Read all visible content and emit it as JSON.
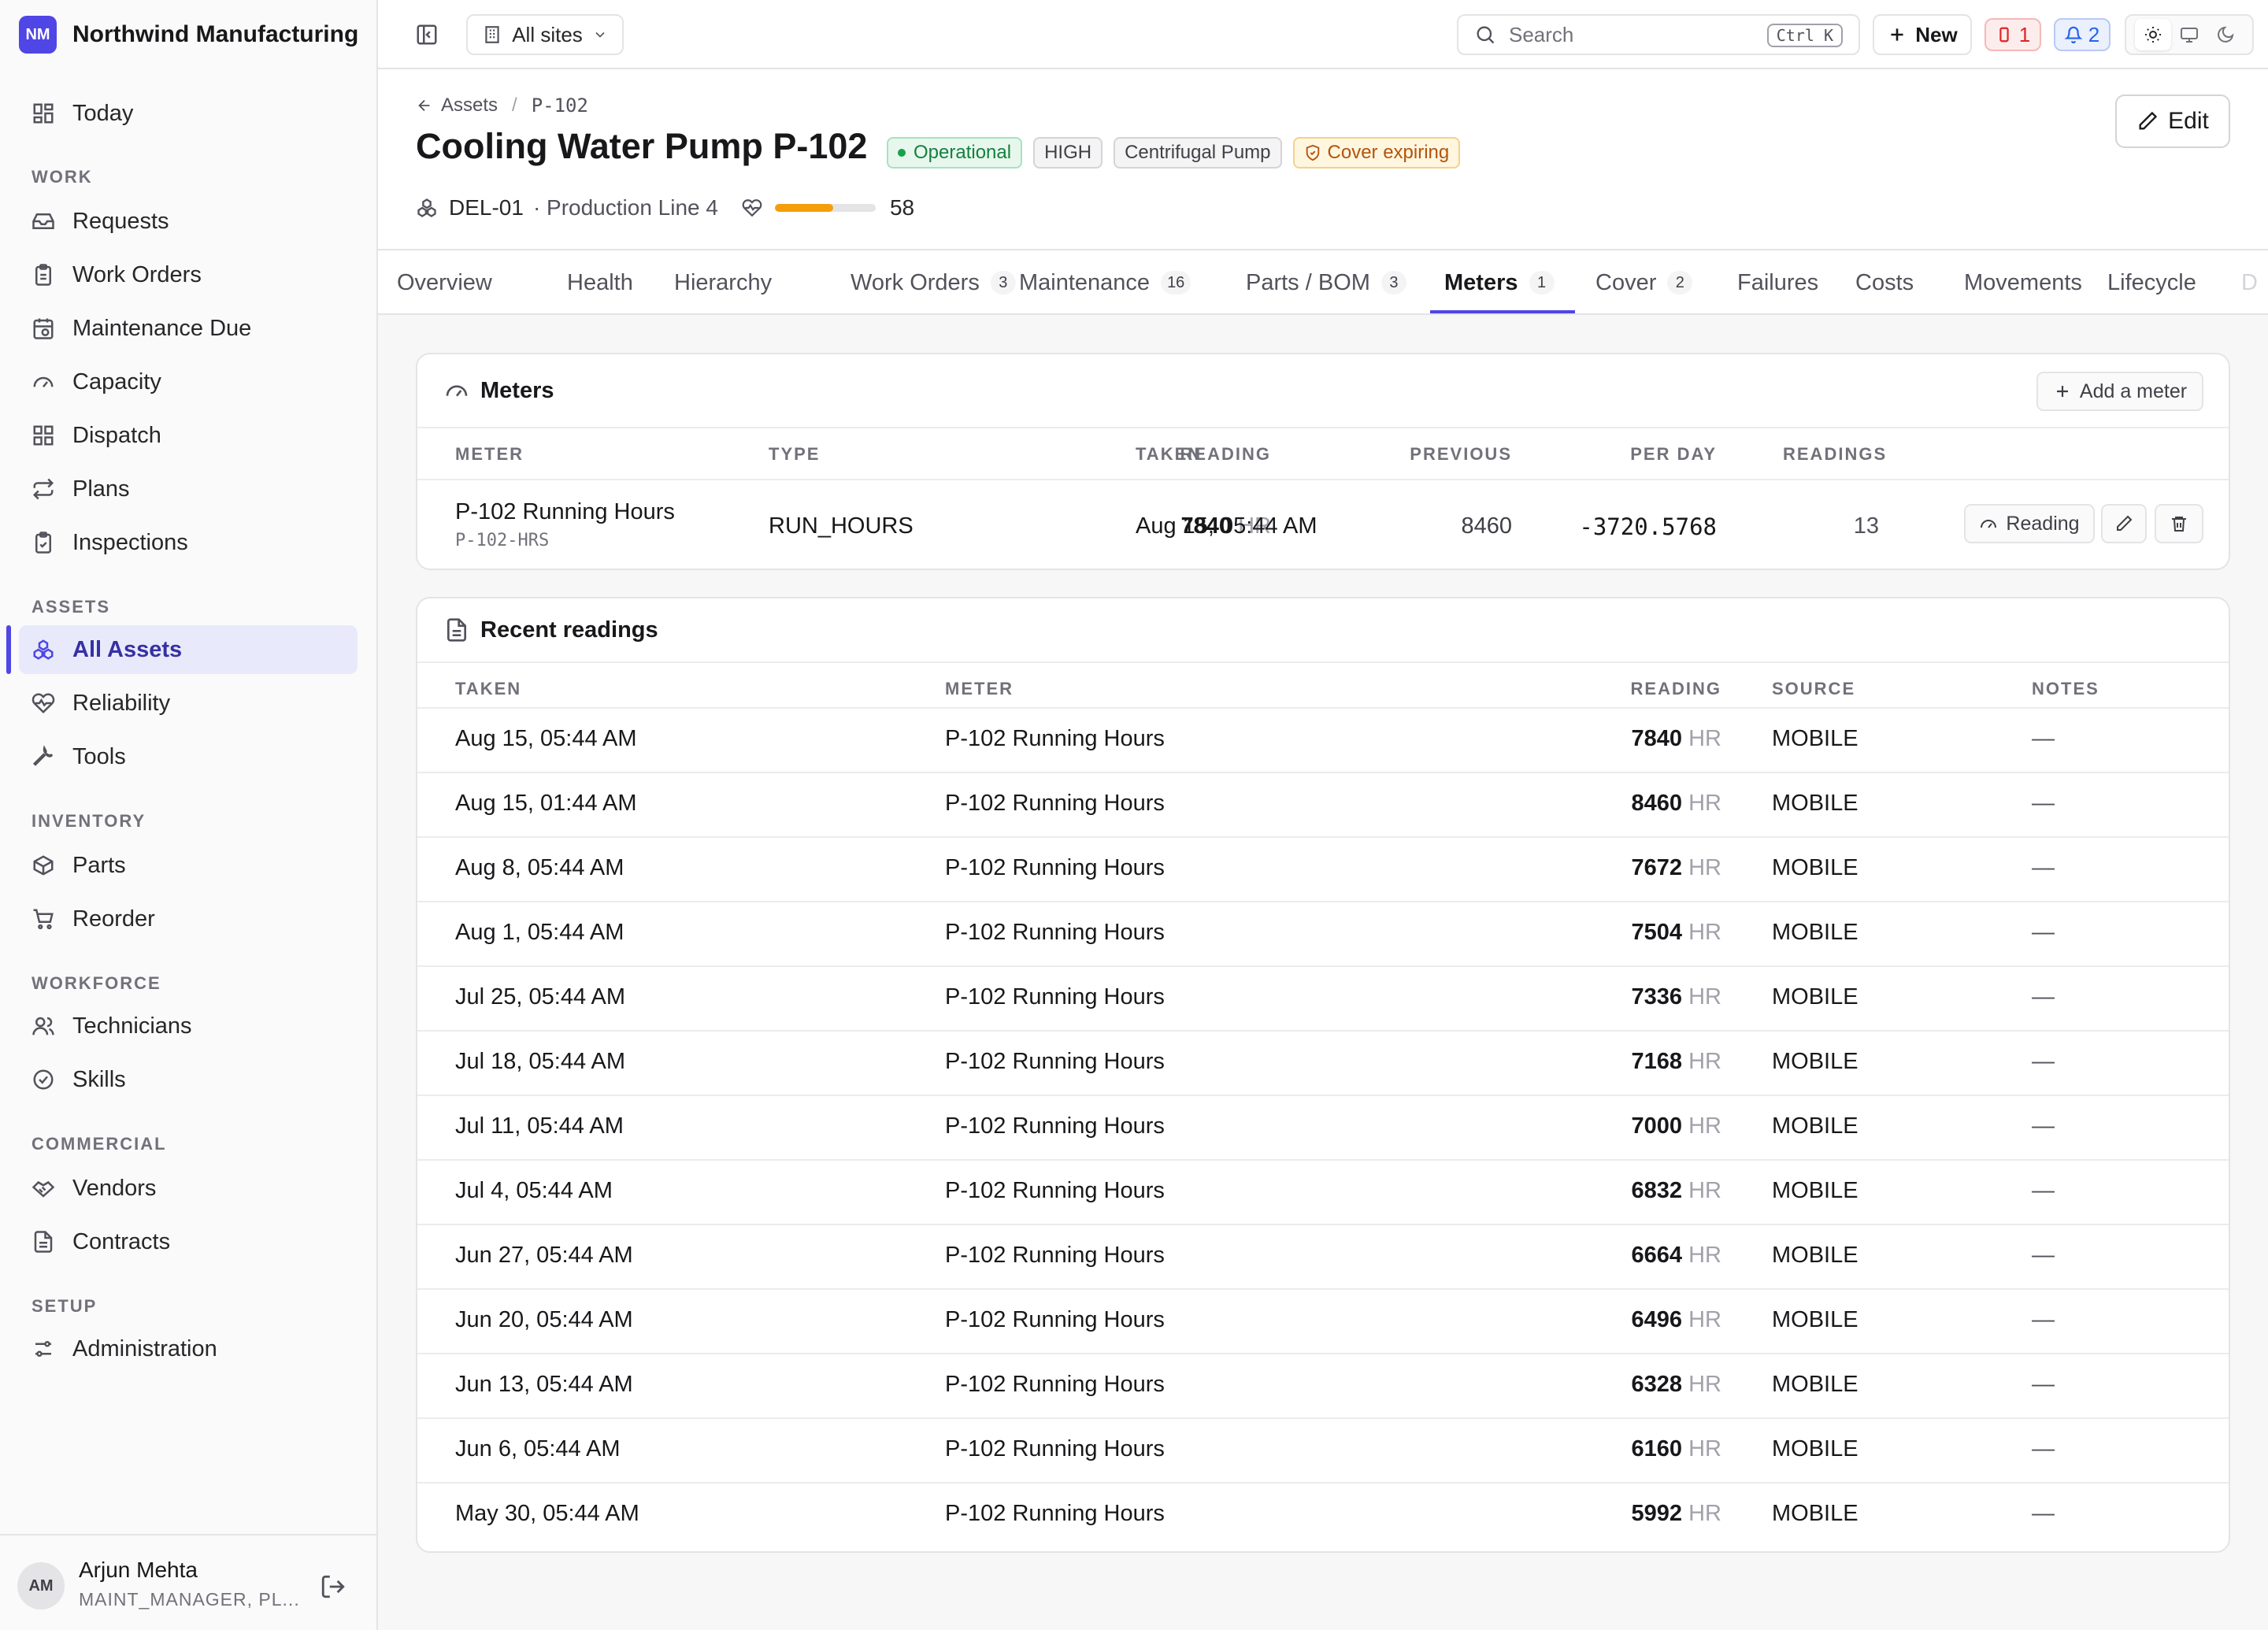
{
  "brand": {
    "initials": "NM",
    "name": "Northwind Manufacturing"
  },
  "nav": {
    "today": "Today",
    "sections": {
      "work": "WORK",
      "assets": "ASSETS",
      "inventory": "INVENTORY",
      "workforce": "WORKFORCE",
      "commercial": "COMMERCIAL",
      "setup": "SETUP"
    },
    "items": {
      "requests": "Requests",
      "work_orders": "Work Orders",
      "maintenance_due": "Maintenance Due",
      "capacity": "Capacity",
      "dispatch": "Dispatch",
      "plans": "Plans",
      "inspections": "Inspections",
      "all_assets": "All Assets",
      "reliability": "Reliability",
      "tools": "Tools",
      "parts": "Parts",
      "reorder": "Reorder",
      "technicians": "Technicians",
      "skills": "Skills",
      "vendors": "Vendors",
      "contracts": "Contracts",
      "administration": "Administration"
    }
  },
  "user": {
    "initials": "AM",
    "name": "Arjun Mehta",
    "role": "MAINT_MANAGER, PL..."
  },
  "topbar": {
    "site": "All sites",
    "search_placeholder": "Search",
    "shortcut": "Ctrl K",
    "new_label": "New",
    "alerts_count": "1",
    "notifications_count": "2"
  },
  "asset": {
    "breadcrumb_parent": "Assets",
    "breadcrumb_current": "P-102",
    "title": "Cooling Water Pump P-102",
    "status": "Operational",
    "criticality": "HIGH",
    "category": "Centrifugal Pump",
    "cover": "Cover expiring",
    "site_code": "DEL-01",
    "location": "· Production Line 4",
    "health_score": "58",
    "health_fraction": 0.58,
    "edit_label": "Edit"
  },
  "tabs": [
    {
      "label": "Overview",
      "count": ""
    },
    {
      "label": "Health",
      "count": ""
    },
    {
      "label": "Hierarchy",
      "count": ""
    },
    {
      "label": "Work Orders",
      "count": "3"
    },
    {
      "label": "Maintenance",
      "count": "16"
    },
    {
      "label": "Parts / BOM",
      "count": "3"
    },
    {
      "label": "Meters",
      "count": "1"
    },
    {
      "label": "Cover",
      "count": "2"
    },
    {
      "label": "Failures",
      "count": ""
    },
    {
      "label": "Costs",
      "count": ""
    },
    {
      "label": "Movements",
      "count": ""
    },
    {
      "label": "Lifecycle",
      "count": ""
    },
    {
      "label": "D",
      "count": ""
    }
  ],
  "meters": {
    "title": "Meters",
    "add_label": "Add a meter",
    "headers": {
      "meter": "METER",
      "type": "TYPE",
      "reading": "READING",
      "taken": "TAKEN",
      "previous": "PREVIOUS",
      "per_day": "PER DAY",
      "readings": "READINGS"
    },
    "row": {
      "name": "P-102 Running Hours",
      "code": "P-102-HRS",
      "type": "RUN_HOURS",
      "reading": "7840",
      "unit": "HR",
      "taken": "Aug 15, 05:44 AM",
      "previous": "8460",
      "per_day": "-3720.5768",
      "readings": "13",
      "reading_button": "Reading"
    }
  },
  "recent": {
    "title": "Recent readings",
    "headers": {
      "taken": "TAKEN",
      "meter": "METER",
      "reading": "READING",
      "source": "SOURCE",
      "notes": "NOTES"
    },
    "rows": [
      {
        "taken": "Aug 15, 05:44 AM",
        "meter": "P-102 Running Hours",
        "reading": "7840",
        "unit": "HR",
        "source": "MOBILE",
        "notes": "—"
      },
      {
        "taken": "Aug 15, 01:44 AM",
        "meter": "P-102 Running Hours",
        "reading": "8460",
        "unit": "HR",
        "source": "MOBILE",
        "notes": "—"
      },
      {
        "taken": "Aug 8, 05:44 AM",
        "meter": "P-102 Running Hours",
        "reading": "7672",
        "unit": "HR",
        "source": "MOBILE",
        "notes": "—"
      },
      {
        "taken": "Aug 1, 05:44 AM",
        "meter": "P-102 Running Hours",
        "reading": "7504",
        "unit": "HR",
        "source": "MOBILE",
        "notes": "—"
      },
      {
        "taken": "Jul 25, 05:44 AM",
        "meter": "P-102 Running Hours",
        "reading": "7336",
        "unit": "HR",
        "source": "MOBILE",
        "notes": "—"
      },
      {
        "taken": "Jul 18, 05:44 AM",
        "meter": "P-102 Running Hours",
        "reading": "7168",
        "unit": "HR",
        "source": "MOBILE",
        "notes": "—"
      },
      {
        "taken": "Jul 11, 05:44 AM",
        "meter": "P-102 Running Hours",
        "reading": "7000",
        "unit": "HR",
        "source": "MOBILE",
        "notes": "—"
      },
      {
        "taken": "Jul 4, 05:44 AM",
        "meter": "P-102 Running Hours",
        "reading": "6832",
        "unit": "HR",
        "source": "MOBILE",
        "notes": "—"
      },
      {
        "taken": "Jun 27, 05:44 AM",
        "meter": "P-102 Running Hours",
        "reading": "6664",
        "unit": "HR",
        "source": "MOBILE",
        "notes": "—"
      },
      {
        "taken": "Jun 20, 05:44 AM",
        "meter": "P-102 Running Hours",
        "reading": "6496",
        "unit": "HR",
        "source": "MOBILE",
        "notes": "—"
      },
      {
        "taken": "Jun 13, 05:44 AM",
        "meter": "P-102 Running Hours",
        "reading": "6328",
        "unit": "HR",
        "source": "MOBILE",
        "notes": "—"
      },
      {
        "taken": "Jun 6, 05:44 AM",
        "meter": "P-102 Running Hours",
        "reading": "6160",
        "unit": "HR",
        "source": "MOBILE",
        "notes": "—"
      },
      {
        "taken": "May 30, 05:44 AM",
        "meter": "P-102 Running Hours",
        "reading": "5992",
        "unit": "HR",
        "source": "MOBILE",
        "notes": "—"
      }
    ]
  },
  "colors": {
    "accent": "#4f46e5",
    "health": "#f59e0b",
    "operational": "#16a34a",
    "alert": "#dc2626"
  }
}
